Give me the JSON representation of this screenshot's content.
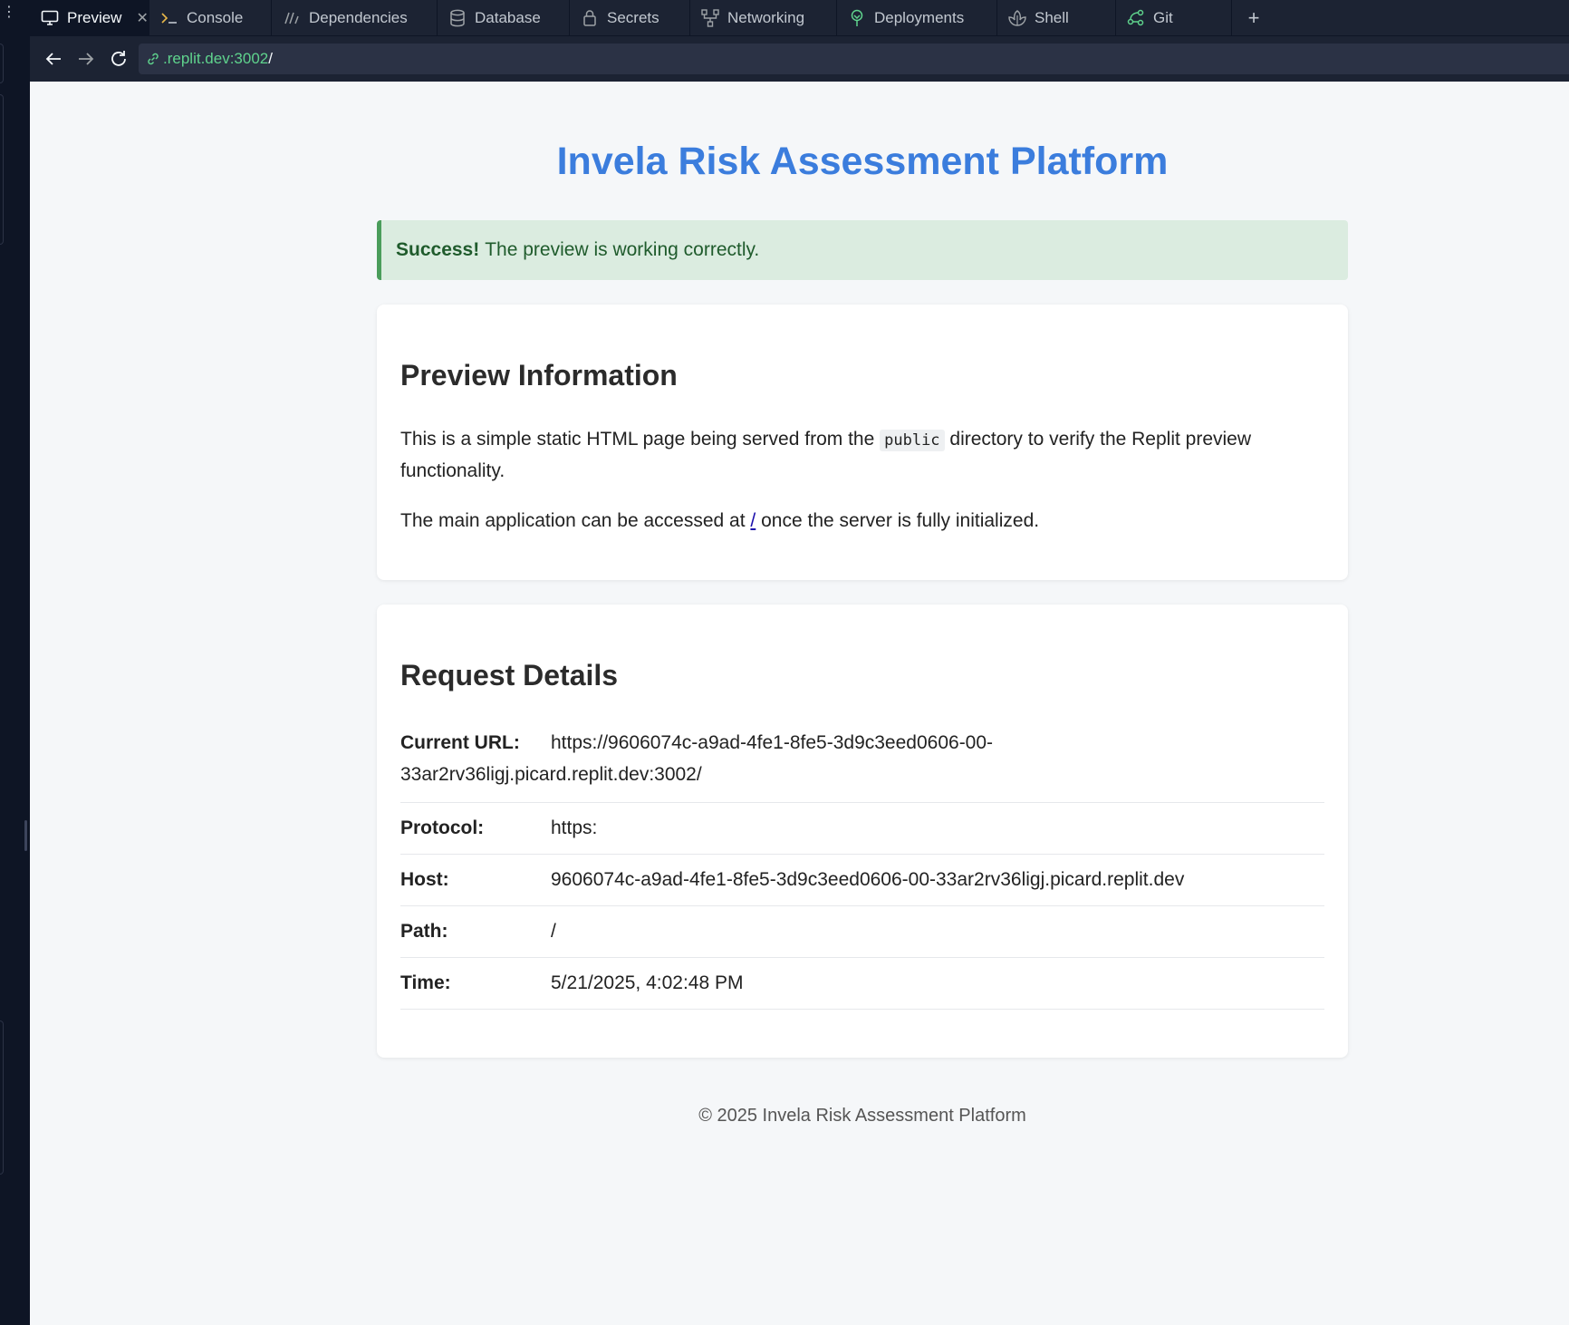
{
  "tabs": [
    {
      "label": "Preview",
      "icon": "monitor-icon",
      "active": true
    },
    {
      "label": "Console",
      "icon": "terminal-icon"
    },
    {
      "label": "Dependencies",
      "icon": "dependencies-icon"
    },
    {
      "label": "Database",
      "icon": "database-icon"
    },
    {
      "label": "Secrets",
      "icon": "lock-icon"
    },
    {
      "label": "Networking",
      "icon": "network-icon"
    },
    {
      "label": "Deployments",
      "icon": "deploy-icon"
    },
    {
      "label": "Shell",
      "icon": "shell-icon"
    },
    {
      "label": "Git",
      "icon": "git-icon"
    }
  ],
  "address": {
    "host": ".replit.dev:3002",
    "path": "/"
  },
  "page": {
    "title": "Invela Risk Assessment Platform",
    "alert": {
      "strong": "Success!",
      "text": "The preview is working correctly."
    },
    "info": {
      "heading": "Preview Information",
      "p1_before": "This is a simple static HTML page being served from the",
      "p1_code": "public",
      "p1_after": "directory to verify the Replit preview functionality.",
      "p2_before": "The main application can be accessed at",
      "p2_link": "/",
      "p2_after": "once the server is fully initialized."
    },
    "request": {
      "heading": "Request Details",
      "current_url_label": "Current URL:",
      "current_url_value": "https://9606074c-a9ad-4fe1-8fe5-3d9c3eed0606-00-33ar2rv36ligj.picard.replit.dev:3002/",
      "rows": [
        {
          "label": "Protocol:",
          "value": "https:"
        },
        {
          "label": "Host:",
          "value": "9606074c-a9ad-4fe1-8fe5-3d9c3eed0606-00-33ar2rv36ligj.picard.replit.dev"
        },
        {
          "label": "Path:",
          "value": "/"
        },
        {
          "label": "Time:",
          "value": "5/21/2025, 4:02:48 PM"
        }
      ]
    },
    "footer": "© 2025 Invela Risk Assessment Platform"
  },
  "colors": {
    "title": "#3b7ddd",
    "success_bg": "#dbece0",
    "success_border": "#4a9d5b",
    "url_host": "#5fd38d"
  }
}
